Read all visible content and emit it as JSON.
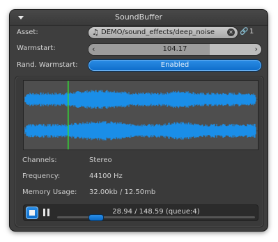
{
  "window": {
    "title": "SoundBuffer"
  },
  "fields": {
    "asset_label": "Asset:",
    "asset_value": "DEMO/sound_effects/deep_noise",
    "asset_links": "1",
    "warmstart_label": "Warmstart:",
    "warmstart_value": "104.17",
    "warmstart_fraction": 0.7,
    "rand_warmstart_label": "Rand. Warmstart:",
    "rand_warmstart_value": "Enabled"
  },
  "info": {
    "channels_label": "Channels:",
    "channels_value": "Stereo",
    "frequency_label": "Frequency:",
    "frequency_value": "44100 Hz",
    "memory_label": "Memory Usage:",
    "memory_value": "32.00kb / 12.50mb"
  },
  "player": {
    "time_text": "28.94 / 148.59 (queue:4)",
    "progress_fraction": 0.195
  },
  "waveform": {
    "playhead_fraction": 0.19
  },
  "colors": {
    "accent": "#1a7fdd",
    "waveform": "#1a8ee8",
    "playhead": "#33dd33",
    "panel": "#3e3e3e"
  },
  "icons": {
    "collapse": "triangle-down-icon",
    "asset": "music-note-icon",
    "clear": "close-icon",
    "link": "link-icon",
    "stop": "stop-icon",
    "pause": "pause-icon"
  }
}
